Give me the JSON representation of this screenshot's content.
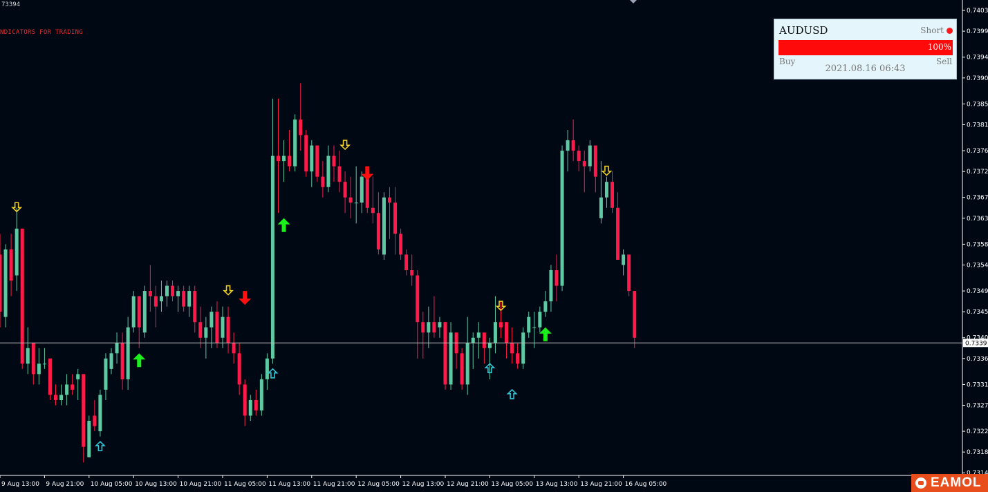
{
  "header": {
    "top_price": "73394",
    "label": "NDICATORS FOR TRADING"
  },
  "panel": {
    "symbol": "AUDUSD",
    "direction": "Short",
    "percent": "100%",
    "strength": 1.0,
    "buy_label": "Buy",
    "sell_label": "Sell",
    "timestamp": "2021.08.16 06:43",
    "accent": "#ff0a0a"
  },
  "brand": {
    "text": "EAMOL",
    "icon": "robot-icon",
    "color": "#e84e1b"
  },
  "colors": {
    "background": "#000814",
    "bull": "#5fc9a3",
    "bear": "#ff1a4a",
    "axis": "#ffffff",
    "current_line": "#bfbfbf"
  },
  "chart_data": {
    "type": "candlestick",
    "symbol": "AUDUSD",
    "ylim": [
      0.73135,
      0.7405
    ],
    "current_price": 0.7339,
    "current_price_label": "0.7339",
    "y_ticks": [
      {
        "v": 0.7403,
        "label": "0.7403"
      },
      {
        "v": 0.7399,
        "label": "0.7399"
      },
      {
        "v": 0.7394,
        "label": "0.7394"
      },
      {
        "v": 0.739,
        "label": "0.7390"
      },
      {
        "v": 0.7385,
        "label": "0.7385"
      },
      {
        "v": 0.7381,
        "label": "0.7381"
      },
      {
        "v": 0.7376,
        "label": "0.7376"
      },
      {
        "v": 0.7372,
        "label": "0.7372"
      },
      {
        "v": 0.7367,
        "label": "0.7367"
      },
      {
        "v": 0.7363,
        "label": "0.7363"
      },
      {
        "v": 0.7358,
        "label": "0.7358"
      },
      {
        "v": 0.7354,
        "label": "0.7354"
      },
      {
        "v": 0.7349,
        "label": "0.7349"
      },
      {
        "v": 0.7345,
        "label": "0.7345"
      },
      {
        "v": 0.734,
        "label": "0.7340"
      },
      {
        "v": 0.7336,
        "label": "0.7336"
      },
      {
        "v": 0.7331,
        "label": "0.7331"
      },
      {
        "v": 0.7327,
        "label": "0.7327"
      },
      {
        "v": 0.7322,
        "label": "0.7322"
      },
      {
        "v": 0.7318,
        "label": "0.7318"
      },
      {
        "v": 0.7314,
        "label": "0.7314"
      }
    ],
    "x_ticks": [
      {
        "i": 0,
        "label": "9 Aug 13:00"
      },
      {
        "i": 8,
        "label": "9 Aug 21:00"
      },
      {
        "i": 16,
        "label": "10 Aug 05:00"
      },
      {
        "i": 24,
        "label": "10 Aug 13:00"
      },
      {
        "i": 32,
        "label": "10 Aug 21:00"
      },
      {
        "i": 40,
        "label": "11 Aug 05:00"
      },
      {
        "i": 48,
        "label": "11 Aug 13:00"
      },
      {
        "i": 56,
        "label": "11 Aug 21:00"
      },
      {
        "i": 64,
        "label": "12 Aug 05:00"
      },
      {
        "i": 72,
        "label": "12 Aug 13:00"
      },
      {
        "i": 80,
        "label": "12 Aug 21:00"
      },
      {
        "i": 88,
        "label": "13 Aug 05:00"
      },
      {
        "i": 96,
        "label": "13 Aug 13:00"
      },
      {
        "i": 104,
        "label": "13 Aug 21:00"
      },
      {
        "i": 112,
        "label": "16 Aug 05:00"
      }
    ],
    "candles": [
      [
        0.7356,
        0.736,
        0.7342,
        0.7345
      ],
      [
        0.7344,
        0.7358,
        0.7342,
        0.7357
      ],
      [
        0.7357,
        0.736,
        0.7348,
        0.7351
      ],
      [
        0.7352,
        0.7365,
        0.7349,
        0.7361
      ],
      [
        0.7361,
        0.7361,
        0.7334,
        0.7335
      ],
      [
        0.7335,
        0.7342,
        0.7333,
        0.7338
      ],
      [
        0.7339,
        0.7339,
        0.7331,
        0.7333
      ],
      [
        0.7333,
        0.7338,
        0.7331,
        0.7335
      ],
      [
        0.7335,
        0.7338,
        0.7334,
        0.7335
      ],
      [
        0.7336,
        0.7336,
        0.7328,
        0.7329
      ],
      [
        0.7329,
        0.7331,
        0.7327,
        0.7328
      ],
      [
        0.7328,
        0.7331,
        0.7327,
        0.7329
      ],
      [
        0.7329,
        0.7333,
        0.7327,
        0.7331
      ],
      [
        0.7331,
        0.7333,
        0.7329,
        0.733
      ],
      [
        0.7332,
        0.7334,
        0.7328,
        0.7333
      ],
      [
        0.7333,
        0.7333,
        0.7316,
        0.7319
      ],
      [
        0.7317,
        0.7325,
        0.7317,
        0.7324
      ],
      [
        0.7325,
        0.7328,
        0.7322,
        0.7323
      ],
      [
        0.7322,
        0.733,
        0.7321,
        0.7329
      ],
      [
        0.733,
        0.7337,
        0.7328,
        0.7336
      ],
      [
        0.7334,
        0.7338,
        0.7333,
        0.7337
      ],
      [
        0.7337,
        0.7341,
        0.7335,
        0.7339
      ],
      [
        0.7339,
        0.7341,
        0.733,
        0.7332
      ],
      [
        0.7332,
        0.7344,
        0.733,
        0.7342
      ],
      [
        0.7342,
        0.7349,
        0.7341,
        0.7348
      ],
      [
        0.7348,
        0.7348,
        0.7338,
        0.7342
      ],
      [
        0.7341,
        0.735,
        0.734,
        0.7349
      ],
      [
        0.7349,
        0.7354,
        0.7345,
        0.7348
      ],
      [
        0.7348,
        0.735,
        0.7342,
        0.7346
      ],
      [
        0.7347,
        0.7351,
        0.7345,
        0.7348
      ],
      [
        0.7348,
        0.7351,
        0.7346,
        0.735
      ],
      [
        0.735,
        0.7351,
        0.7347,
        0.7348
      ],
      [
        0.7348,
        0.735,
        0.7345,
        0.7349
      ],
      [
        0.7349,
        0.735,
        0.7345,
        0.7346
      ],
      [
        0.7346,
        0.735,
        0.7344,
        0.7349
      ],
      [
        0.7349,
        0.735,
        0.7341,
        0.7343
      ],
      [
        0.7343,
        0.7346,
        0.7338,
        0.734
      ],
      [
        0.734,
        0.7344,
        0.7336,
        0.7342
      ],
      [
        0.7342,
        0.7346,
        0.7338,
        0.7345
      ],
      [
        0.7345,
        0.7347,
        0.7338,
        0.7339
      ],
      [
        0.734,
        0.7346,
        0.7338,
        0.7344
      ],
      [
        0.7344,
        0.7346,
        0.7337,
        0.7339
      ],
      [
        0.7339,
        0.7341,
        0.7335,
        0.7337
      ],
      [
        0.7337,
        0.7339,
        0.7329,
        0.7331
      ],
      [
        0.7331,
        0.7332,
        0.7323,
        0.7325
      ],
      [
        0.7325,
        0.7329,
        0.7324,
        0.7328
      ],
      [
        0.7328,
        0.733,
        0.7325,
        0.7326
      ],
      [
        0.7326,
        0.7333,
        0.7325,
        0.7332
      ],
      [
        0.7332,
        0.7337,
        0.733,
        0.7336
      ],
      [
        0.7336,
        0.7386,
        0.7335,
        0.7375
      ],
      [
        0.7375,
        0.7386,
        0.7364,
        0.7374
      ],
      [
        0.7374,
        0.7378,
        0.737,
        0.7375
      ],
      [
        0.7375,
        0.738,
        0.7372,
        0.7373
      ],
      [
        0.7373,
        0.7383,
        0.7372,
        0.7382
      ],
      [
        0.7382,
        0.7389,
        0.7376,
        0.7379
      ],
      [
        0.7379,
        0.738,
        0.7371,
        0.7372
      ],
      [
        0.7372,
        0.7378,
        0.7369,
        0.7377
      ],
      [
        0.7377,
        0.7377,
        0.737,
        0.7371
      ],
      [
        0.7371,
        0.7374,
        0.7367,
        0.7369
      ],
      [
        0.7369,
        0.7377,
        0.7368,
        0.7375
      ],
      [
        0.7375,
        0.7377,
        0.737,
        0.7373
      ],
      [
        0.7373,
        0.7376,
        0.7368,
        0.737
      ],
      [
        0.737,
        0.7372,
        0.7364,
        0.7367
      ],
      [
        0.7367,
        0.7371,
        0.7363,
        0.7366
      ],
      [
        0.7366,
        0.7373,
        0.7362,
        0.7366
      ],
      [
        0.7366,
        0.7372,
        0.7364,
        0.7371
      ],
      [
        0.7371,
        0.7372,
        0.7364,
        0.7365
      ],
      [
        0.7365,
        0.7371,
        0.7362,
        0.7364
      ],
      [
        0.7364,
        0.7368,
        0.7356,
        0.7357
      ],
      [
        0.7356,
        0.7368,
        0.7355,
        0.7367
      ],
      [
        0.7367,
        0.7369,
        0.7359,
        0.7366
      ],
      [
        0.7366,
        0.7369,
        0.7356,
        0.736
      ],
      [
        0.736,
        0.7361,
        0.7355,
        0.7356
      ],
      [
        0.7356,
        0.7357,
        0.7352,
        0.7353
      ],
      [
        0.7353,
        0.7356,
        0.735,
        0.7352
      ],
      [
        0.7352,
        0.7353,
        0.7336,
        0.7343
      ],
      [
        0.7343,
        0.7345,
        0.7336,
        0.7341
      ],
      [
        0.7341,
        0.7346,
        0.7338,
        0.7343
      ],
      [
        0.7343,
        0.7348,
        0.734,
        0.7341
      ],
      [
        0.7342,
        0.7344,
        0.734,
        0.7343
      ],
      [
        0.7343,
        0.7343,
        0.733,
        0.7331
      ],
      [
        0.7331,
        0.7343,
        0.733,
        0.7341
      ],
      [
        0.7341,
        0.7341,
        0.7334,
        0.7337
      ],
      [
        0.7337,
        0.7338,
        0.733,
        0.7331
      ],
      [
        0.7331,
        0.7344,
        0.7329,
        0.7339
      ],
      [
        0.7339,
        0.7341,
        0.7334,
        0.734
      ],
      [
        0.734,
        0.7343,
        0.7336,
        0.7341
      ],
      [
        0.7341,
        0.7341,
        0.7335,
        0.7338
      ],
      [
        0.7338,
        0.734,
        0.7332,
        0.7339
      ],
      [
        0.7339,
        0.7348,
        0.7337,
        0.7343
      ],
      [
        0.7343,
        0.7347,
        0.734,
        0.7342
      ],
      [
        0.7343,
        0.7343,
        0.7336,
        0.7339
      ],
      [
        0.7339,
        0.7342,
        0.7335,
        0.7337
      ],
      [
        0.7337,
        0.7339,
        0.7334,
        0.7335
      ],
      [
        0.7335,
        0.7342,
        0.7334,
        0.7341
      ],
      [
        0.7341,
        0.7345,
        0.734,
        0.7344
      ],
      [
        0.7342,
        0.7345,
        0.7338,
        0.7342
      ],
      [
        0.7342,
        0.7346,
        0.7341,
        0.7345
      ],
      [
        0.7345,
        0.7349,
        0.7344,
        0.7347
      ],
      [
        0.7347,
        0.7354,
        0.7345,
        0.7353
      ],
      [
        0.7353,
        0.7356,
        0.7347,
        0.735
      ],
      [
        0.735,
        0.7377,
        0.7349,
        0.7376
      ],
      [
        0.7376,
        0.738,
        0.7372,
        0.7378
      ],
      [
        0.7378,
        0.7382,
        0.7374,
        0.7376
      ],
      [
        0.7376,
        0.7377,
        0.7372,
        0.7374
      ],
      [
        0.7374,
        0.7376,
        0.7368,
        0.7373
      ],
      [
        0.7373,
        0.7378,
        0.7372,
        0.7377
      ],
      [
        0.7377,
        0.7377,
        0.7368,
        0.7371
      ],
      [
        0.7363,
        0.7374,
        0.7362,
        0.7367
      ],
      [
        0.7367,
        0.7371,
        0.7365,
        0.737
      ],
      [
        0.737,
        0.7372,
        0.7364,
        0.7365
      ],
      [
        0.7365,
        0.7368,
        0.7355,
        0.7355
      ],
      [
        0.7354,
        0.7357,
        0.7352,
        0.7356
      ],
      [
        0.7356,
        0.7356,
        0.7348,
        0.7349
      ],
      [
        0.7349,
        0.7349,
        0.7338,
        0.734
      ]
    ],
    "signals": [
      {
        "i": 3,
        "kind": "small-down",
        "price": 0.7366
      },
      {
        "i": 18,
        "kind": "small-up",
        "price": 0.732
      },
      {
        "i": 25,
        "kind": "big-up",
        "price": 0.7337
      },
      {
        "i": 41,
        "kind": "small-down",
        "price": 0.735
      },
      {
        "i": 44,
        "kind": "big-down",
        "price": 0.7349
      },
      {
        "i": 49,
        "kind": "small-up",
        "price": 0.7334
      },
      {
        "i": 51,
        "kind": "big-up",
        "price": 0.7363
      },
      {
        "i": 62,
        "kind": "small-down",
        "price": 0.7378
      },
      {
        "i": 66,
        "kind": "big-down",
        "price": 0.7373
      },
      {
        "i": 88,
        "kind": "small-up",
        "price": 0.7335
      },
      {
        "i": 90,
        "kind": "small-down",
        "price": 0.7347
      },
      {
        "i": 92,
        "kind": "small-up",
        "price": 0.733
      },
      {
        "i": 98,
        "kind": "big-up",
        "price": 0.7342
      },
      {
        "i": 109,
        "kind": "small-down",
        "price": 0.7373
      }
    ]
  }
}
